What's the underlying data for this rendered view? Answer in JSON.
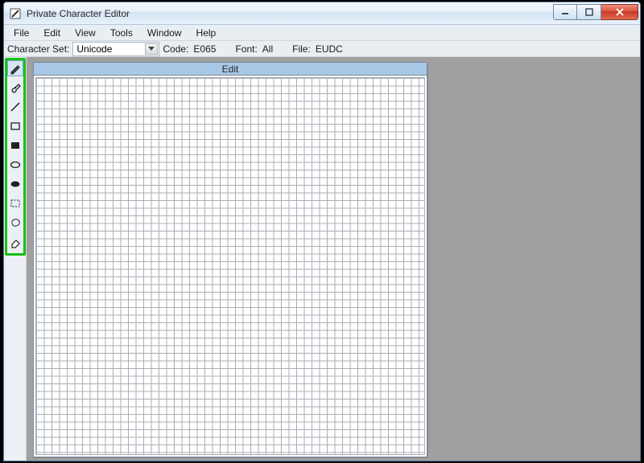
{
  "window": {
    "title": "Private Character Editor"
  },
  "menu": {
    "items": [
      "File",
      "Edit",
      "View",
      "Tools",
      "Window",
      "Help"
    ]
  },
  "infobar": {
    "charset_label": "Character Set:",
    "charset_value": "Unicode",
    "code_label": "Code:",
    "code_value": "E065",
    "font_label": "Font:",
    "font_value": "All",
    "file_label": "File:",
    "file_value": "EUDC"
  },
  "edit_panel": {
    "title": "Edit"
  },
  "tools": [
    {
      "name": "pencil-icon",
      "selected": true
    },
    {
      "name": "brush-icon",
      "selected": false
    },
    {
      "name": "line-icon",
      "selected": false
    },
    {
      "name": "rectangle-icon",
      "selected": false
    },
    {
      "name": "filled-rectangle-icon",
      "selected": false
    },
    {
      "name": "ellipse-icon",
      "selected": false
    },
    {
      "name": "filled-ellipse-icon",
      "selected": false
    },
    {
      "name": "rect-select-icon",
      "selected": false
    },
    {
      "name": "freeform-select-icon",
      "selected": false
    },
    {
      "name": "eraser-icon",
      "selected": false
    }
  ]
}
